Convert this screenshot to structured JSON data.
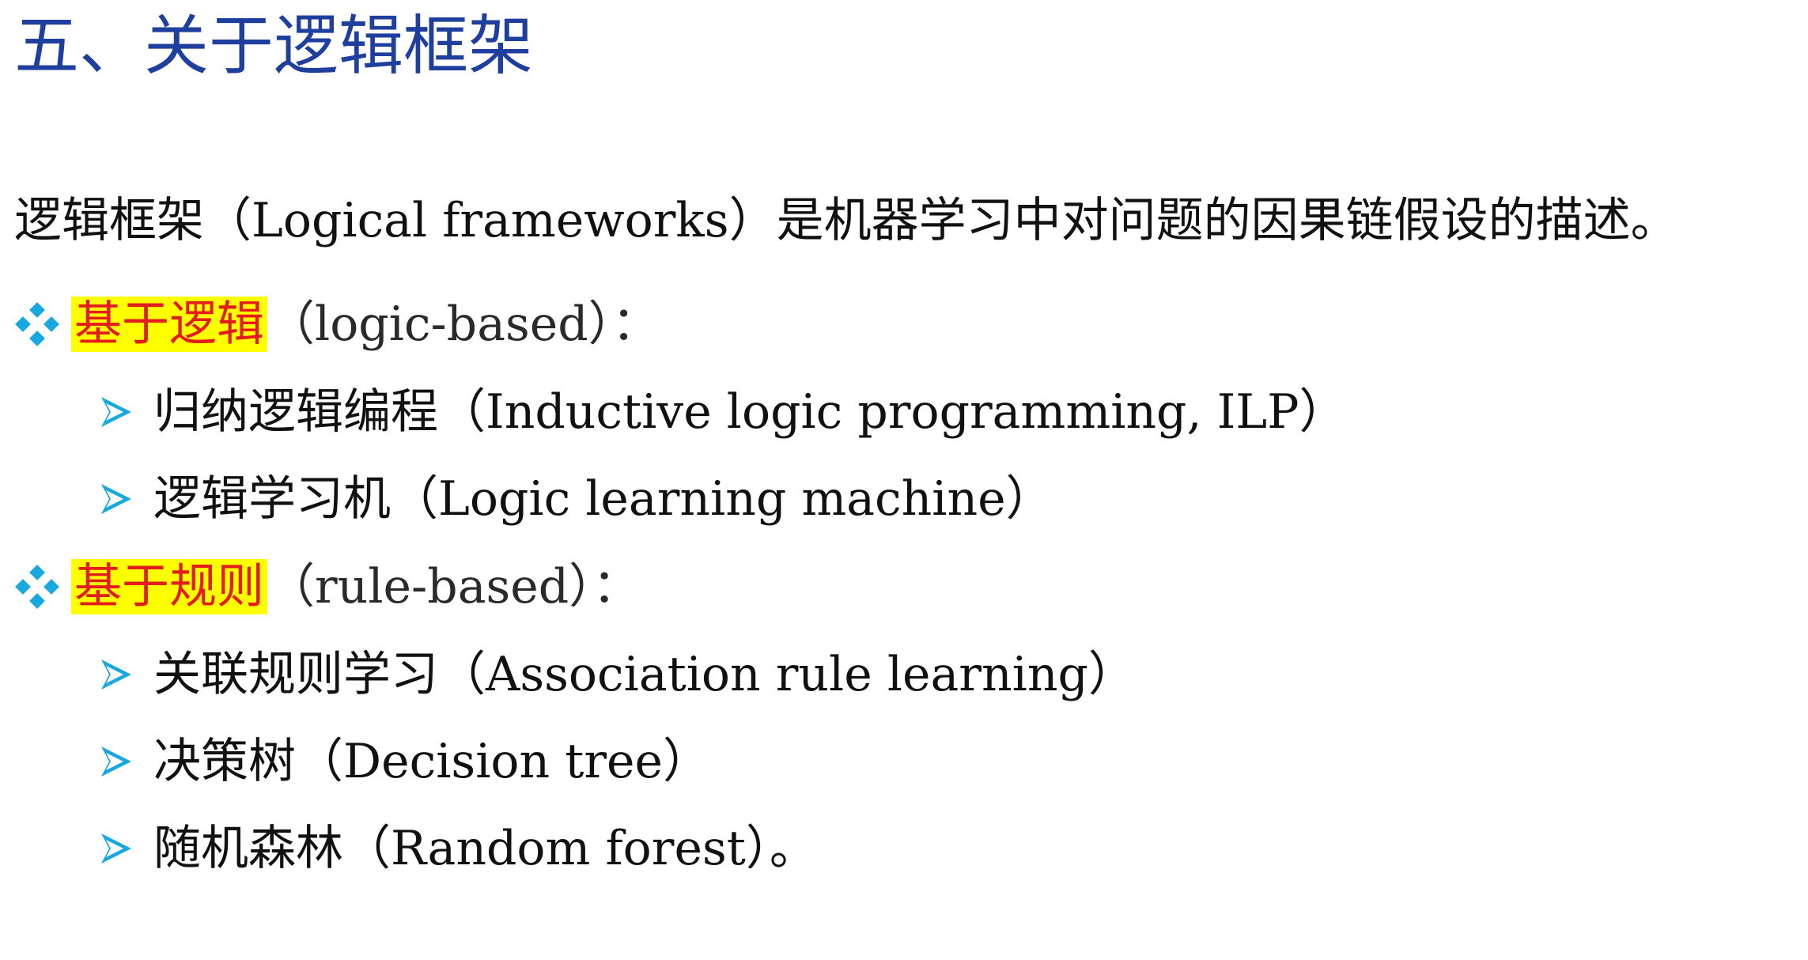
{
  "title": "五、关于逻辑框架",
  "intro": "逻辑框架（Logical frameworks）是机器学习中对问题的因果链假设的描述。",
  "sections": [
    {
      "label": "基于逻辑",
      "suffix": "（logic-based）：",
      "items": [
        "归纳逻辑编程（Inductive logic programming, ILP）",
        "逻辑学习机（Logic learning machine）"
      ]
    },
    {
      "label": "基于规则",
      "suffix": "（rule-based）：",
      "items": [
        "关联规则学习（Association rule learning）",
        "决策树（Decision tree）",
        "随机森林（Random forest）。"
      ]
    }
  ],
  "colors": {
    "title": "#1f3f9f",
    "bullet_diamond": "#18a8e0",
    "bullet_arrow": "#18a8e0",
    "highlight_bg": "#ffff00",
    "highlight_text": "#e31d1d"
  },
  "icons": {
    "category_bullet": "diamond-bullet-icon",
    "item_bullet": "arrow-bullet-icon"
  }
}
